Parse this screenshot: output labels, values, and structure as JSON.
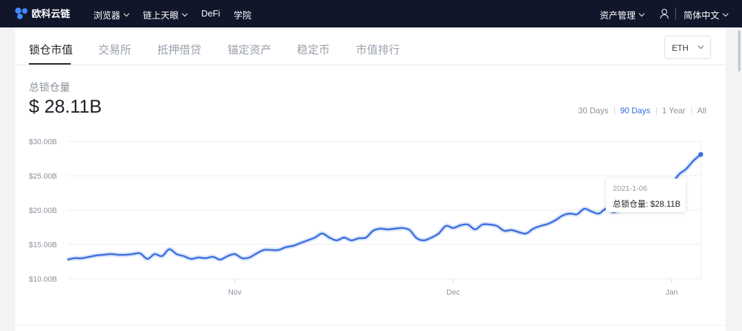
{
  "nav": {
    "brand": "欧科云链",
    "items": [
      {
        "label": "浏览器",
        "dropdown": true
      },
      {
        "label": "链上天眼",
        "dropdown": true
      },
      {
        "label": "DeFi",
        "dropdown": false
      },
      {
        "label": "学院",
        "dropdown": false
      }
    ],
    "asset_mgmt": "资产管理",
    "language": "简体中文",
    "user_icon": "user-icon"
  },
  "tabs": [
    "锁仓市值",
    "交易所",
    "抵押借贷",
    "锚定资产",
    "稳定币",
    "市值排行"
  ],
  "active_tab": 0,
  "currency_select": "ETH",
  "tvl": {
    "label": "总锁仓量",
    "value": "$ 28.11B"
  },
  "ranges": [
    "30 Days",
    "90 Days",
    "1 Year",
    "All"
  ],
  "active_range": 1,
  "tooltip": {
    "date": "2021-1-06",
    "label": "总锁仓量: $28.11B"
  },
  "colors": {
    "nav_bg": "#11162b",
    "accent": "#3366e0",
    "line": "#3b6fe0"
  },
  "chart_data": {
    "type": "line",
    "title": "",
    "xlabel": "",
    "ylabel": "",
    "ylim": [
      10,
      30
    ],
    "yticks": [
      "$10.00B",
      "$15.00B",
      "$20.00B",
      "$25.00B",
      "$30.00B"
    ],
    "yticks_values": [
      10,
      15,
      20,
      25,
      30
    ],
    "xticks": [
      "Nov",
      "Dec",
      "Jan"
    ],
    "xticks_index": [
      23,
      53,
      83
    ],
    "grid": true,
    "series": [
      {
        "name": "总锁仓量",
        "unit": "B USD",
        "values": [
          12.8,
          13.0,
          13.0,
          13.2,
          13.4,
          13.5,
          13.6,
          13.5,
          13.5,
          13.6,
          13.7,
          12.9,
          13.6,
          13.3,
          14.3,
          13.6,
          13.3,
          12.9,
          13.1,
          13.0,
          13.2,
          12.8,
          13.3,
          13.6,
          13.0,
          13.1,
          13.7,
          14.2,
          14.2,
          14.2,
          14.6,
          14.8,
          15.2,
          15.6,
          16.0,
          16.6,
          16.0,
          15.6,
          16.0,
          15.6,
          15.9,
          16.0,
          17.0,
          17.3,
          17.2,
          17.3,
          17.4,
          17.1,
          15.9,
          15.6,
          16.0,
          16.6,
          17.7,
          17.4,
          17.8,
          17.9,
          17.2,
          17.9,
          17.9,
          17.7,
          17.0,
          17.1,
          16.8,
          16.6,
          17.3,
          17.7,
          18.0,
          18.5,
          19.2,
          19.5,
          19.4,
          20.2,
          19.8,
          19.5,
          20.2,
          19.7,
          20.0,
          20.2,
          20.5,
          21.2,
          21.8,
          22.5,
          23.0,
          23.8,
          25.2,
          26.0,
          27.2,
          28.11
        ]
      }
    ]
  }
}
